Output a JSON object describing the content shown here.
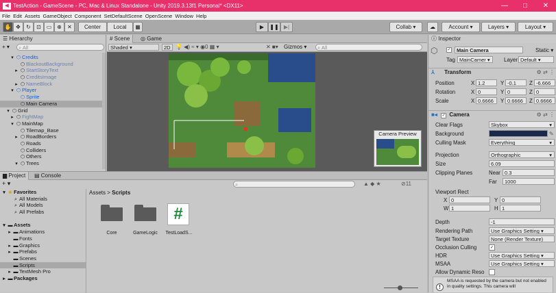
{
  "window": {
    "title": "TestAction - GameScene - PC, Mac & Linux Standalone - Unity 2019.3.13f1 Personal* <DX11>",
    "controls": [
      "—",
      "□",
      "✕"
    ]
  },
  "menu": [
    "File",
    "Edit",
    "Assets",
    "GameObject",
    "Component",
    "SetDefaultScene",
    "OpenScene",
    "Window",
    "Help"
  ],
  "toolbar": {
    "center_label": "Center",
    "local_label": "Local",
    "collab_label": "Collab ▾",
    "account_label": "Account ▾",
    "layers_label": "Layers ▾",
    "layout_label": "Layout ▾",
    "play": "▶",
    "pause": "❚❚",
    "step": "▶|"
  },
  "hierarchy": {
    "title": "Hierarchy",
    "add_label": "+ ▾",
    "search_placeholder": "All",
    "items": [
      {
        "text": "Credits",
        "style": "blue"
      },
      {
        "text": "BlackoutBackground",
        "style": "fade"
      },
      {
        "text": "StartStoryText",
        "style": "fade"
      },
      {
        "text": "CreditsImage",
        "style": "fade"
      },
      {
        "text": "NameBlock",
        "style": "fade"
      },
      {
        "text": "Player",
        "style": "blue"
      },
      {
        "text": "Sprite",
        "style": "blue"
      },
      {
        "text": "Main Camera",
        "style": "sel"
      },
      {
        "text": "Grid",
        "style": ""
      },
      {
        "text": "FightMap",
        "style": "fade"
      },
      {
        "text": "MainMap",
        "style": ""
      },
      {
        "text": "Tilemap_Base",
        "style": ""
      },
      {
        "text": "RoadBorders",
        "style": ""
      },
      {
        "text": "Roads",
        "style": ""
      },
      {
        "text": "Colliders",
        "style": ""
      },
      {
        "text": "Others",
        "style": ""
      },
      {
        "text": "Trees",
        "style": ""
      }
    ]
  },
  "scene": {
    "tab_scene": "Scene",
    "tab_game": "Game",
    "shading": "Shaded",
    "mode_2d": "2D",
    "gizmos": "Gizmos ▾",
    "search_placeholder": "All",
    "camera_preview": "Camera Preview"
  },
  "project": {
    "tab_project": "Project",
    "tab_console": "Console",
    "breadcrumb_root": "Assets",
    "breadcrumb_sep": ">",
    "breadcrumb_leaf": "Scripts",
    "hidden_count": "11",
    "favorites_label": "Favorites",
    "favorites": [
      "All Materials",
      "All Models",
      "All Prefabs"
    ],
    "assets_label": "Assets",
    "asset_folders": [
      "Animations",
      "Fonts",
      "Graphics",
      "Prefabs",
      "Scenes",
      "Scripts",
      "TextMesh Pro"
    ],
    "packages_label": "Packages",
    "files": [
      "Core",
      "GameLogic",
      "TestLoadS..."
    ],
    "script_glyph": "#"
  },
  "inspector": {
    "title": "Inspector",
    "object_name": "Main Camera",
    "static_label": "Static ▾",
    "tag_label": "Tag",
    "tag_value": "MainCamer ▾",
    "layer_label": "Layer",
    "layer_value": "Default ▾",
    "transform": {
      "title": "Transform",
      "position_label": "Position",
      "rotation_label": "Rotation",
      "scale_label": "Scale",
      "position": [
        "1.2",
        "-0.1",
        "-6.666"
      ],
      "rotation": [
        "0",
        "0",
        "0"
      ],
      "scale": [
        "0.6666",
        "0.6666",
        "0.6666"
      ]
    },
    "camera": {
      "title": "Camera",
      "clear_flags_label": "Clear Flags",
      "clear_flags": "Skybox",
      "background_label": "Background",
      "background_color": "#1b2a4a",
      "culling_label": "Culling Mask",
      "culling": "Everything",
      "projection_label": "Projection",
      "projection": "Orthographic",
      "size_label": "Size",
      "size": "6.09",
      "clipping_label": "Clipping Planes",
      "near_label": "Near",
      "near": "0.3",
      "far_label": "Far",
      "far": "1000",
      "viewport_label": "Viewport Rect",
      "vx": "0",
      "vy": "0",
      "vw": "1",
      "vh": "1",
      "depth_label": "Depth",
      "depth": "-1",
      "rendering_label": "Rendering Path",
      "rendering": "Use Graphics Setting ▾",
      "target_label": "Target Texture",
      "target": "None (Render Texture)",
      "occlusion_label": "Occlusion Culling",
      "hdr_label": "HDR",
      "hdr": "Use Graphics Setting ▾",
      "msaa_label": "MSAA",
      "msaa": "Use Graphics Setting ▾",
      "dynres_label": "Allow Dynamic Reso",
      "warning": "MSAA is requested by the camera but not enabled in quality settings. This camera will"
    }
  },
  "colors": {
    "title_bar": "#e8316b",
    "accent_blue": "#1a5fd1"
  }
}
